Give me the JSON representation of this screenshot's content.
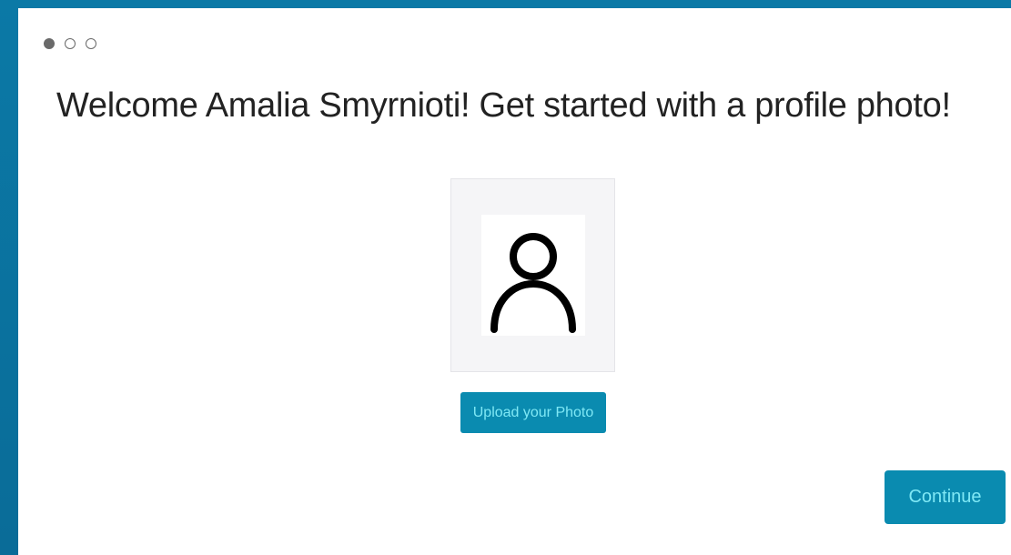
{
  "onboarding": {
    "steps": [
      {
        "state": "active"
      },
      {
        "state": "inactive"
      },
      {
        "state": "inactive"
      }
    ],
    "welcome_text": "Welcome Amalia Smyrnioti! Get started with a profile photo!",
    "avatar_icon": "person-outline-icon",
    "upload_label": "Upload your Photo",
    "continue_label": "Continue"
  },
  "colors": {
    "accent": "#0a8bb0",
    "button_text": "#7fe8f5",
    "background": "#0a6e9a"
  }
}
